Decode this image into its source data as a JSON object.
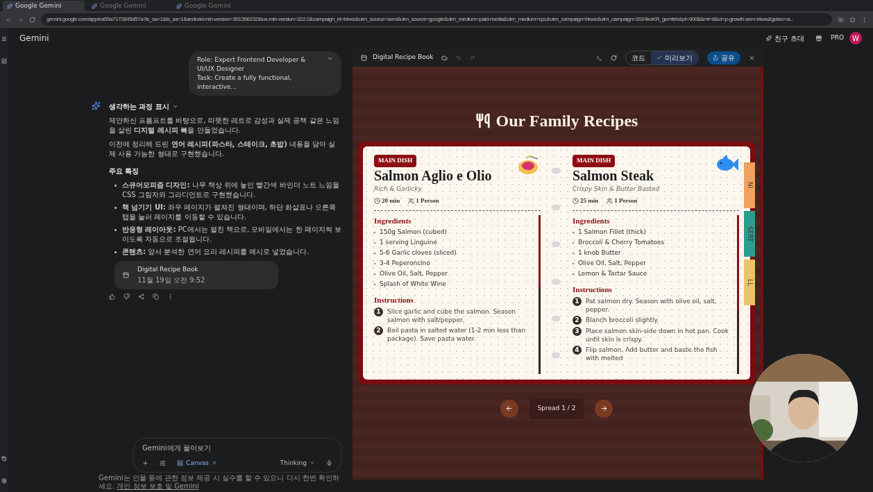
{
  "browser": {
    "tabs": [
      {
        "label": "Google Gemini",
        "selected": true
      },
      {
        "label": "Google Gemini",
        "selected": false
      },
      {
        "label": "Google Gemini",
        "selected": false
      }
    ],
    "url": "gemini.google.com/app/ea55a7172845d57a?is_sa=1&is_sa=1&android-min-version=301356232&ios-min-version=322.0&campaign_id=bkws&utm_source=sem&utm_source=google&utm_medium=paid-media&utm_medium=cpc&utm_campaign=bkws&utm_campaign=2024koKR_gemfeb&pt=9008&mt=8&ct=p-growth-sem-bkws&gclsrc=a..."
  },
  "header": {
    "title": "Gemini",
    "invite": "친구 초대",
    "plan": "PRO",
    "avatar": "W"
  },
  "chat": {
    "prompt": [
      "Role: Expert Frontend Developer & UI/UX Designer",
      "Task: Create a fully functional, interactive..."
    ],
    "thinking": "생각하는 과정 표시",
    "paragraphs": [
      "제안하신 프롬프트를 바탕으로, 따뜻한 레트로 감성과 실제 공책 같은 느낌을 살린 **디지털 레시피 북**을 만들었습니다.",
      "이전에 정리해 드린 **연어 레시피(파스타, 스테이크, 초밥)** 내용을 담아 실제 사용 가능한 형태로 구현했습니다."
    ],
    "features_title": "주요 특징",
    "features": [
      "**스큐어모피즘 디자인:** 나무 책상 위에 놓인 빨간색 바인더 노트 느낌을 CSS 그림자와 그라디언트로 구현했습니다.",
      "**책 넘기기 UI:** 좌우 페이지가 펼쳐진 형태이며, 하단 화살표나 오른쪽 탭을 눌러 페이지를 이동할 수 있습니다.",
      "**반응형 레이아웃:** PC에서는 펼친 책으로, 모바일에서는 한 페이지씩 보이도록 자동으로 조절됩니다.",
      "**콘텐츠:** 앞서 분석한 연어 요리 레시피를 예시로 넣었습니다."
    ],
    "card": {
      "title": "Digital Recipe Book",
      "time": "11월 19일 오전 9:52"
    },
    "input": {
      "placeholder": "Gemini에게 물어보기",
      "tool": "Canvas",
      "mode": "Thinking"
    },
    "disclaimer": "Gemini는 인물 등에 관한 정보 제공 시 실수를 할 수 있으니 다시 한번 확인하세요.",
    "disclaimer_link": "개인 정보 보호 및 Gemini"
  },
  "canvas": {
    "title": "Digital Recipe Book",
    "views": [
      {
        "label": "코드",
        "selected": false
      },
      {
        "label": "미리보기",
        "selected": true
      }
    ],
    "share": "공유",
    "book_title": "Our Family Recipes",
    "pages": [
      {
        "badge": "MAIN DISH",
        "title": "Salmon Aglio e Olio",
        "subtitle": "Rich & Garlicky",
        "time": "20 min",
        "serves": "1 Person",
        "kind": "pasta",
        "ingredients_title": "Ingredients",
        "ingredients": [
          "150g Salmon (cubed)",
          "1 serving Linguine",
          "5-6 Garlic cloves (sliced)",
          "3-4 Peperoncino",
          "Olive Oil, Salt, Pepper",
          "Splash of White Wine"
        ],
        "instructions_title": "Instructions",
        "steps": [
          {
            "n": "1",
            "text": "Slice garlic and cube the salmon. Season salmon with salt/pepper."
          },
          {
            "n": "2",
            "text": "Boil pasta in salted water (1-2 min less than package). Save pasta water."
          }
        ]
      },
      {
        "badge": "MAIN DISH",
        "title": "Salmon Steak",
        "subtitle": "Crispy Skin & Butter Basted",
        "time": "25 min",
        "serves": "1 Person",
        "kind": "fish",
        "ingredients_title": "Ingredients",
        "ingredients": [
          "1 Salmon Fillet (thick)",
          "Broccoli & Cherry Tomatoes",
          "1 knob Butter",
          "Olive Oil, Salt, Pepper",
          "Lemon & Tartar Sauce"
        ],
        "instructions_title": "Instructions",
        "steps": [
          {
            "n": "1",
            "text": "Pat salmon dry. Season with olive oil, salt, pepper."
          },
          {
            "n": "2",
            "text": "Blanch broccoli slightly."
          },
          {
            "n": "3",
            "text": "Place salmon skin-side down in hot pan. Cook until skin is crispy."
          },
          {
            "n": "4",
            "text": "Flip salmon. Add butter and baste the fish with melted"
          }
        ]
      }
    ],
    "side_tabs": [
      {
        "label": "NI",
        "color": "#f0a060"
      },
      {
        "label": "SERT",
        "color": "#2a9d8f"
      },
      {
        "label": "LL",
        "color": "#e9c46a"
      }
    ],
    "spread": "Spread 1 / 2"
  }
}
